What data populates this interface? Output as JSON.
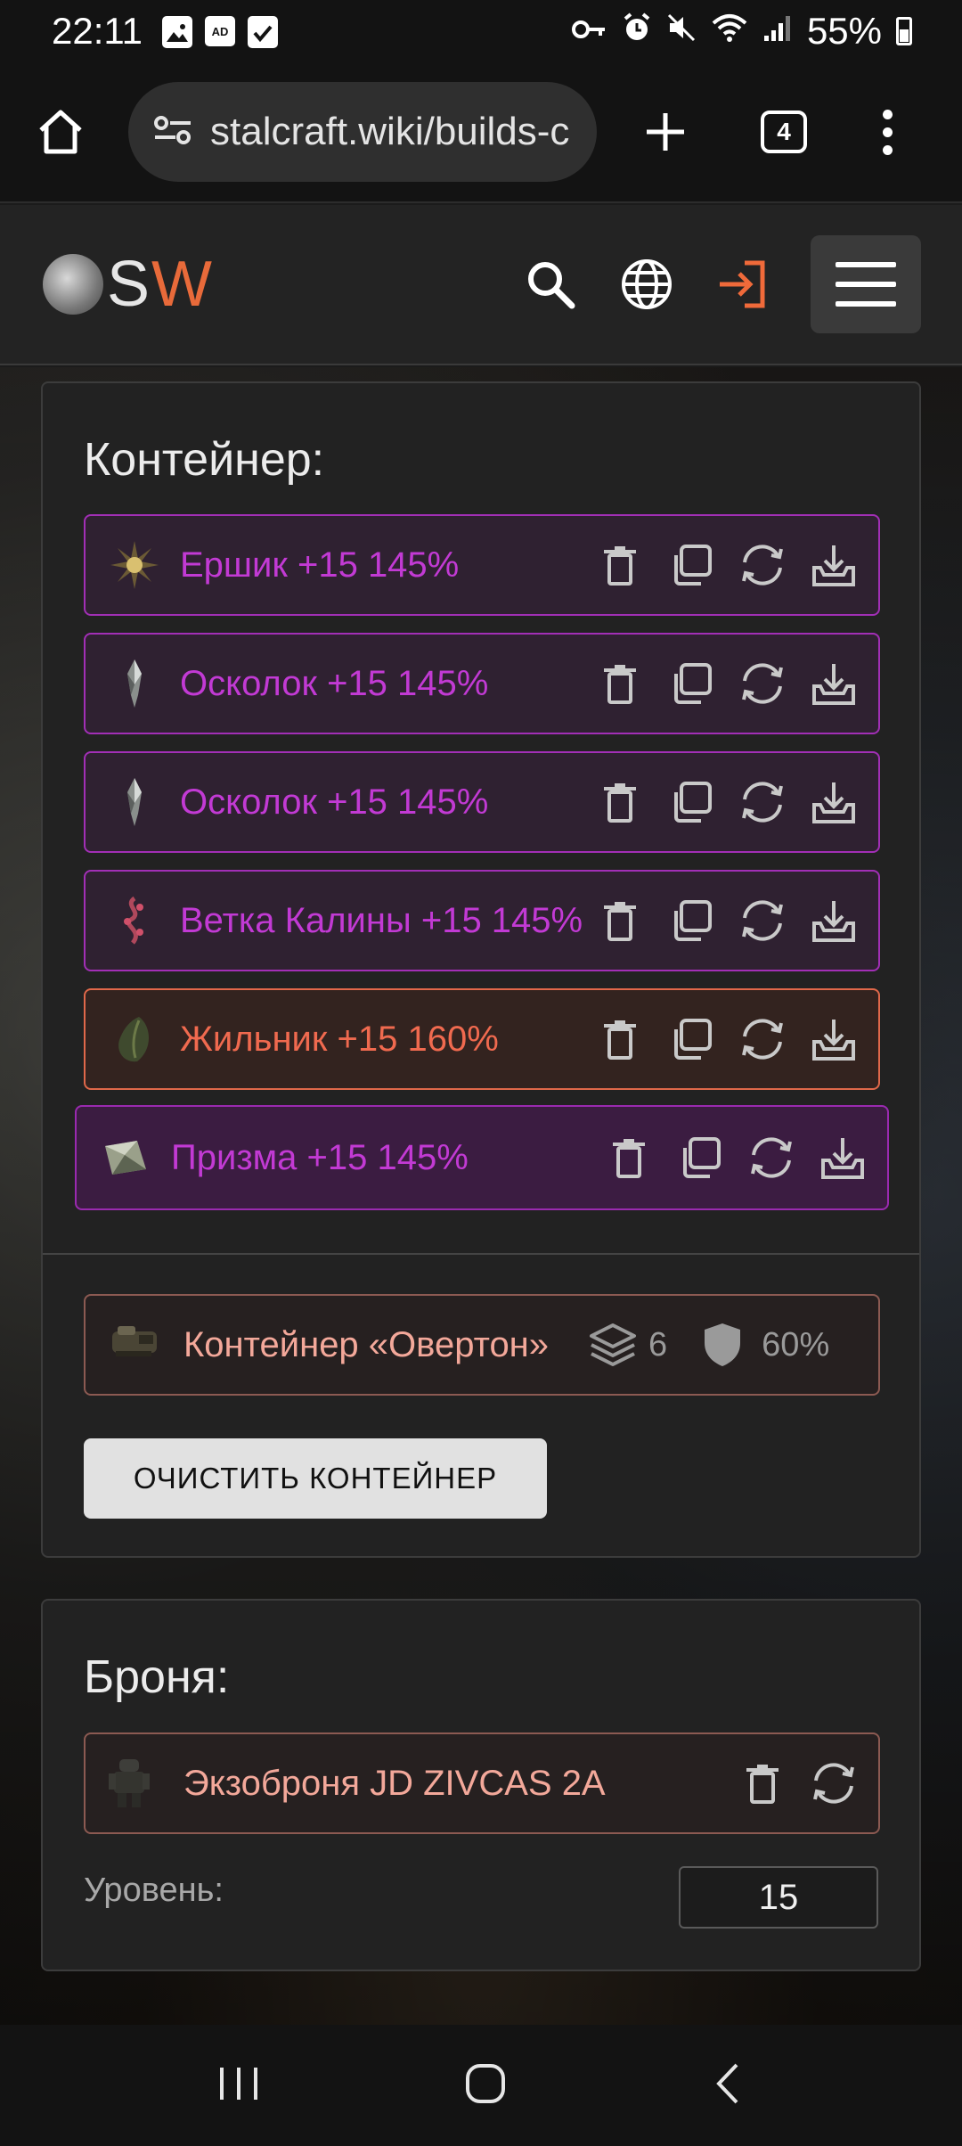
{
  "status_bar": {
    "time": "22:11",
    "ad_icon_text": "AD",
    "battery": "55%"
  },
  "browser": {
    "url": "stalcraft.wiki/builds-c",
    "tab_count": "4"
  },
  "site": {
    "logo_s": "S",
    "logo_w": "W"
  },
  "container_panel": {
    "title": "Контейнер:",
    "items": [
      {
        "name": "Ершик +15 145%"
      },
      {
        "name": "Осколок +15 145%"
      },
      {
        "name": "Осколок +15 145%"
      },
      {
        "name": "Ветка Калины +15 145%"
      },
      {
        "name": "Жильник +15 160%"
      },
      {
        "name": "Призма +15 145%"
      }
    ],
    "container": {
      "name": "Контейнер «Овертон»",
      "slots": "6",
      "protection": "60%"
    },
    "clear_button": "ОЧИСТИТЬ КОНТЕЙНЕР"
  },
  "armor_panel": {
    "title": "Броня:",
    "item": "Экзоброня JD ZIVCAS 2A",
    "level_label": "Уровень:",
    "level_value": "15"
  },
  "colors": {
    "artifact_purple": "#c23ad4",
    "artifact_orange": "#f06a4f",
    "logo_accent": "#e86a3a",
    "login_accent": "#f06a3a"
  }
}
